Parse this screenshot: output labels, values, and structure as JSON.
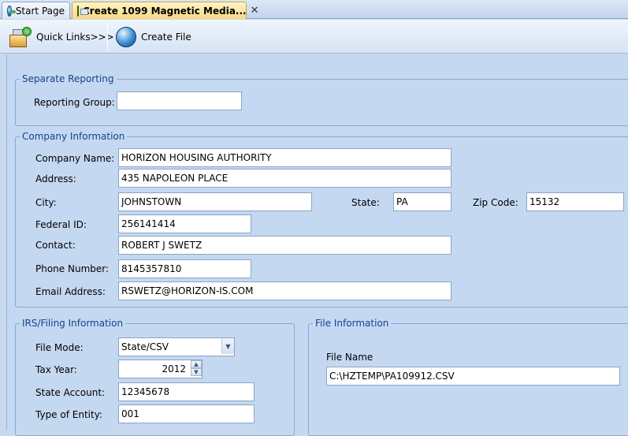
{
  "tabs": {
    "start": "Start Page",
    "active": "Create 1099 Magnetic Media...",
    "close_glyph": "✕"
  },
  "toolbar": {
    "quick_links": "Quick Links>>>",
    "create_file": "Create File"
  },
  "separate_reporting": {
    "legend": "Separate Reporting",
    "reporting_group_label": "Reporting Group:",
    "reporting_group_value": ""
  },
  "company": {
    "legend": "Company Information",
    "name_label": "Company Name:",
    "name_value": "HORIZON HOUSING AUTHORITY",
    "address_label": "Address:",
    "address_value": "435 NAPOLEON PLACE",
    "city_label": "City:",
    "city_value": "JOHNSTOWN",
    "state_label": "State:",
    "state_value": "PA",
    "zip_label": "Zip Code:",
    "zip_value": "15132",
    "federal_id_label": "Federal ID:",
    "federal_id_value": "256141414",
    "contact_label": "Contact:",
    "contact_value": "ROBERT J SWETZ",
    "phone_label": "Phone Number:",
    "phone_value": "8145357810",
    "email_label": "Email Address:",
    "email_value": "RSWETZ@HORIZON-IS.COM"
  },
  "irs": {
    "legend": "IRS/Filing Information",
    "file_mode_label": "File Mode:",
    "file_mode_value": "State/CSV",
    "tax_year_label": "Tax Year:",
    "tax_year_value": "2012",
    "state_account_label": "State Account:",
    "state_account_value": "12345678",
    "entity_label": "Type of Entity:",
    "entity_value": "001"
  },
  "file_info": {
    "legend": "File Information",
    "file_name_label": "File Name",
    "file_name_value": "C:\\HZTEMP\\PA109912.CSV"
  }
}
